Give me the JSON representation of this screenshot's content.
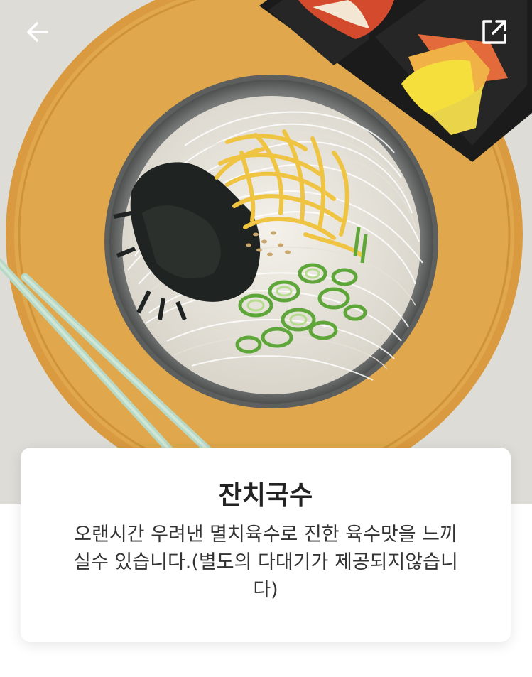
{
  "header": {
    "back_icon": "arrow-left-icon",
    "share_icon": "share-external-icon"
  },
  "hero": {
    "image": "janchi-guksu-photo",
    "colors": {
      "mat": "#e0a74c",
      "noodle": "#f3f0e8",
      "egg": "#f0c443",
      "scallion": "#5fa63a",
      "seaweed": "#1f2321"
    }
  },
  "menu": {
    "name": "잔치국수",
    "description": "오랜시간 우려낸 멸치육수로 진한 육수맛을 느끼실수 있습니다.(별도의 다대기가 제공되지않습니다)"
  }
}
